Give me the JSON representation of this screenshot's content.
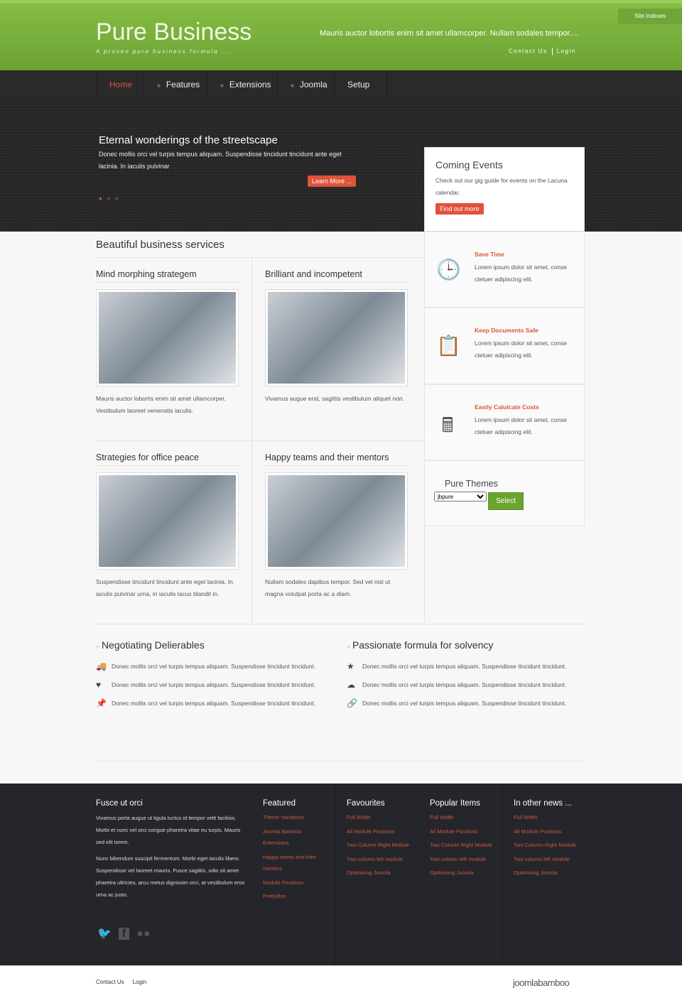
{
  "header": {
    "logo": "Pure Business",
    "tagline": "A proven pure business formula ...",
    "text": "Mauris auctor lobortis enim sit amet ullamcorper. Nullam sodales tempor....",
    "contact": "Contact Us",
    "login": "Login",
    "site_indexes": "Site Indexes"
  },
  "nav": [
    {
      "label": "Home",
      "active": true
    },
    {
      "label": "Features"
    },
    {
      "label": "Extensions"
    },
    {
      "label": "Joomla"
    },
    {
      "label": "Setup"
    }
  ],
  "hero": {
    "title": "Eternal wonderings of the streetscape",
    "text": "Donec mollis orci vel turpis tempus aliquam. Suspendisse tincidunt tincidunt ante eget lacinia. In iaculis pulvinar",
    "button": "Learn More ...",
    "slide_count": 3,
    "active_slide": 1
  },
  "events": {
    "title": "Coming Events",
    "text": "Check out our gig guide for events on the Lacuna calendar.",
    "button": "Find out more"
  },
  "services": {
    "title": "Beautiful business services",
    "cards": [
      {
        "title": "Mind morphing strategem",
        "text": "Mauris auctor lobortis enim sit amet ullamcorper. Vestibulum laoreet venenatis iaculis."
      },
      {
        "title": "Brilliant and incompetent",
        "text": "Vivamus augue erat, sagittis vestibulum aliquet non."
      },
      {
        "title": "Strategies for office peace",
        "text": "Suspendisse tincidunt tincidunt ante eget lacinia. In iaculis pulvinar urna, in iaculis lacus blandit in."
      },
      {
        "title": "Happy teams and their mentors",
        "text": "Nullam sodales dapibus tempor. Sed vel nisl ut magna volutpat porta ac a diam."
      }
    ]
  },
  "sidebar": [
    {
      "title": "Save Time",
      "text": "Lorem ipsum dolor sit amet, conse ctetuer adipiscing elit.",
      "icon": "clock-icon"
    },
    {
      "title": "Keep Documents Safe",
      "text": "Lorem ipsum dolor sit amet, conse ctetuer adipiscing elit.",
      "icon": "clipboard-icon"
    },
    {
      "title": "Easily Calulcate Costs",
      "text": "Lorem ipsum dolor sit amet, conse ctetuer adipiscing elit.",
      "icon": "calculator-icon"
    }
  ],
  "themes": {
    "title": "Pure Themes",
    "selected": "jbpure",
    "button": "Select"
  },
  "features": [
    {
      "title": "Negotiating Delierables",
      "items": [
        {
          "icon": "truck-icon",
          "text": "Donec mollis orci vel turpis tempus aliquam. Suspendisse tincidunt tincidunt."
        },
        {
          "icon": "heart-icon",
          "text": "Donec mollis orci vel turpis tempus aliquam. Suspendisse tincidunt tincidunt."
        },
        {
          "icon": "pushpin-icon",
          "text": "Donec mollis orci vel turpis tempus aliquam. Suspendisse tincidunt tincidunt."
        }
      ]
    },
    {
      "title": "Passionate formula for solvency",
      "items": [
        {
          "icon": "star-icon",
          "text": "Donec mollis orci vel turpis tempus aliquam. Suspendisse tincidunt tincidunt."
        },
        {
          "icon": "cloud-icon",
          "text": "Donec mollis orci vel turpis tempus aliquam. Suspendisse tincidunt tincidunt."
        },
        {
          "icon": "link-icon",
          "text": "Donec mollis orci vel turpis tempus aliquam. Suspendisse tincidunt tincidunt."
        }
      ]
    }
  ],
  "footer": {
    "about": {
      "title": "Fusce ut orci",
      "p1": "Vivamus porta augue ut ligula luctus id tempor velit facilisis. Morbi et nunc vel orci congue pharetra vitae eu turpis. Mauris sed elit lorem.",
      "p2": "Nunc bibendum suscipit fermentum. Morbi eget iaculis libero. Suspendisse vel laoreet mauris. Fusce sagittis, odio sit amet pharetra ultricies, arcu metus dignissim orci, at vestibulum eros urna ac justo."
    },
    "columns": [
      {
        "title": "Featured",
        "links": [
          "Theme Variations",
          "Joomla Bamboo Extensions",
          "Happy teams and their mentors",
          "Module Positions",
          "PrettyBox"
        ]
      },
      {
        "title": "Favourites",
        "links": [
          "Full Width",
          "All Module Positions",
          "Two Column Right Module",
          "Two column left module",
          "Optimising Joomla"
        ]
      },
      {
        "title": "Popular Items",
        "links": [
          "Full Width",
          "All Module Positions",
          "Two Column Right Module",
          "Two column left module",
          "Optimising Joomla"
        ]
      },
      {
        "title": "In other news ...",
        "links": [
          "Full Width",
          "All Module Positions",
          "Two Column Right Module",
          "Two column left module",
          "Optimising Joomla"
        ]
      }
    ]
  },
  "bottom": {
    "contact": "Contact Us",
    "login": "Login",
    "brand": "joomlabamboo"
  },
  "colors": {
    "green": "#78b03c",
    "accent": "#e0523a",
    "dark": "#24262b"
  }
}
